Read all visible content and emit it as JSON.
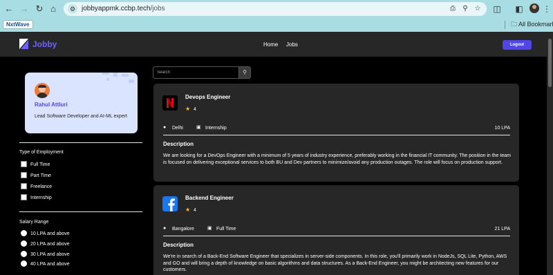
{
  "browser": {
    "url_host": "jobbyappmk.ccbp.tech",
    "url_path": "/jobs",
    "bookmark_chip": "NxtWave",
    "bookmarks_folder": "All Bookmarks"
  },
  "header": {
    "logo_text": "Jobby",
    "nav": [
      "Home",
      "Jobs"
    ],
    "logout_label": "Logout",
    "accent_color": "#4f46e5"
  },
  "profile": {
    "name": "Rahul Attluri",
    "bio": "Lead Software Developer and AI-ML expert"
  },
  "filters": {
    "employment_heading": "Type of Employment",
    "employment_options": [
      "Full Time",
      "Part Time",
      "Freelance",
      "Internship"
    ],
    "salary_heading": "Salary Range",
    "salary_options": [
      "10 LPA and above",
      "20 LPA and above",
      "30 LPA and above",
      "40 LPA and above"
    ]
  },
  "search": {
    "placeholder": "Search"
  },
  "jobs": [
    {
      "company_icon": "netflix-logo",
      "title": "Devops Engineer",
      "rating": "4",
      "location": "Delhi",
      "employment_type": "Internship",
      "package": "10 LPA",
      "description_heading": "Description",
      "description": "We are looking for a DevOps Engineer with a minimum of 5 years of industry experience, preferably working in the financial IT community. The position in the team is focused on delivering exceptional services to both BU and Dev partners to minimize/avoid any production outages. The role will focus on production support."
    },
    {
      "company_icon": "facebook-logo",
      "title": "Backend Engineer",
      "rating": "4",
      "location": "Bangalore",
      "employment_type": "Full Time",
      "package": "21 LPA",
      "description_heading": "Description",
      "description": "We're in search of a Back-End Software Engineer that specializes in server-side components. In this role, you'll primarily work in NodeJs, SQL Lite, Python, AWS and GO and will bring a depth of knowledge on basic algorithms and data structures. As a Back-End Engineer, you might be architecting new features for our customers."
    }
  ]
}
